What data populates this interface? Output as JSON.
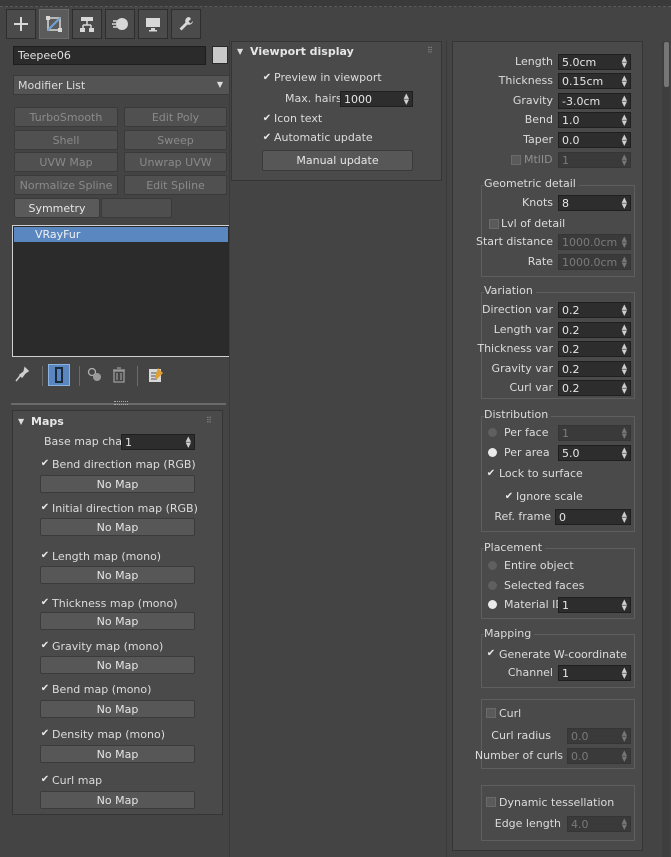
{
  "tabs": [
    {
      "name": "create-tab",
      "icon": "plus-icon"
    },
    {
      "name": "modify-tab",
      "icon": "modify-icon"
    },
    {
      "name": "hierarchy-tab",
      "icon": "hierarchy-icon"
    },
    {
      "name": "motion-tab",
      "icon": "motion-icon"
    },
    {
      "name": "display-tab",
      "icon": "display-icon"
    },
    {
      "name": "utilities-tab",
      "icon": "wrench-icon"
    }
  ],
  "object_name": "Teepee06",
  "modifier_list": "Modifier List",
  "modifier_buttons": [
    "TurboSmooth",
    "Edit Poly",
    "Shell",
    "Sweep",
    "UVW Map",
    "Unwrap UVW",
    "Normalize Spline",
    "Edit Spline",
    "Symmetry"
  ],
  "stack_item": "VRayFur",
  "viewport": {
    "title": "Viewport display",
    "preview": "Preview in viewport",
    "max_hairs_label": "Max. hairs",
    "max_hairs": "1000",
    "icon_text": "Icon text",
    "auto_update": "Automatic update",
    "manual_update": "Manual update"
  },
  "params": {
    "length_label": "Length",
    "length": "5.0cm",
    "thickness_label": "Thickness",
    "thickness": "0.15cm",
    "gravity_label": "Gravity",
    "gravity": "-3.0cm",
    "bend_label": "Bend",
    "bend": "1.0",
    "taper_label": "Taper",
    "taper": "0.0",
    "mtlid_label": "MtlID",
    "mtlid": "1"
  },
  "geometric": {
    "title": "Geometric detail",
    "knots_label": "Knots",
    "knots": "8",
    "lod_label": "Lvl of detail",
    "start_label": "Start distance",
    "start": "1000.0cm",
    "rate_label": "Rate",
    "rate": "1000.0cm"
  },
  "variation": {
    "title": "Variation",
    "dir_label": "Direction var",
    "dir": "0.2",
    "len_label": "Length var",
    "len": "0.2",
    "thick_label": "Thickness var",
    "thick": "0.2",
    "grav_label": "Gravity var",
    "grav": "0.2",
    "curl_label": "Curl var",
    "curl": "0.2"
  },
  "distribution": {
    "title": "Distribution",
    "per_face": "Per face",
    "per_face_val": "1",
    "per_area": "Per area",
    "per_area_val": "5.0",
    "lock": "Lock to surface",
    "ignore": "Ignore scale",
    "ref_label": "Ref. frame",
    "ref": "0"
  },
  "placement": {
    "title": "Placement",
    "entire": "Entire object",
    "selected": "Selected faces",
    "material": "Material ID",
    "material_val": "1"
  },
  "mapping": {
    "title": "Mapping",
    "gen_w": "Generate W-coordinate",
    "channel_label": "Channel",
    "channel": "1"
  },
  "curl": {
    "title": "Curl",
    "radius_label": "Curl radius",
    "radius": "0.0",
    "num_label": "Number of curls",
    "num": "0.0"
  },
  "dyn": {
    "title": "Dynamic tessellation",
    "edge_label": "Edge length",
    "edge": "4.0"
  },
  "maps": {
    "title": "Maps",
    "base_label": "Base map chan",
    "base": "1",
    "no_map": "No Map",
    "items": [
      "Bend direction map (RGB)",
      "Initial direction map (RGB)",
      "Length map (mono)",
      "Thickness map (mono)",
      "Gravity map (mono)",
      "Bend map (mono)",
      "Density map (mono)",
      "Curl map"
    ]
  },
  "nomap": [
    "No Map",
    "No Map",
    "No Map",
    "No Map",
    "No Map",
    "No Map",
    "No Map",
    "No Map"
  ],
  "colors": {
    "bg": "#444444",
    "field": "#2b2b2b",
    "selection": "#5b87c0",
    "accent": "#6fa3d8"
  }
}
